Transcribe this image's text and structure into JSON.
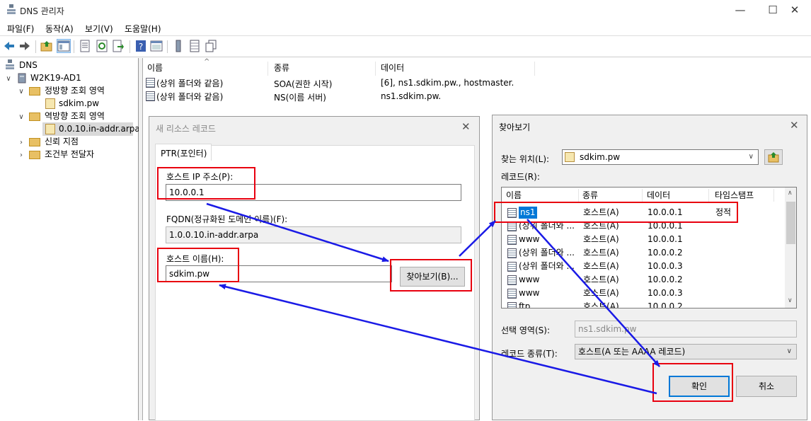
{
  "app": {
    "title": "DNS 관리자",
    "window_controls": {
      "minimize": "—",
      "maximize": "☐",
      "close": "✕"
    }
  },
  "menu": [
    "파일(F)",
    "동작(A)",
    "보기(V)",
    "도움말(H)"
  ],
  "tree": {
    "root": "DNS",
    "server": "W2K19-AD1",
    "forward_zone": "정방향 조회 영역",
    "forward_child": "sdkim.pw",
    "reverse_zone": "역방향 조회 영역",
    "reverse_child": "0.0.10.in-addr.arpa",
    "trust": "신뢰 지점",
    "conditional": "조건부 전달자"
  },
  "list": {
    "headers": {
      "name": "이름",
      "type": "종류",
      "data": "데이터"
    },
    "rows": [
      {
        "name": "(상위 폴더와 같음)",
        "type": "SOA(권한 시작)",
        "data": "[6], ns1.sdkim.pw., hostmaster."
      },
      {
        "name": "(상위 폴더와 같음)",
        "type": "NS(이름 서버)",
        "data": "ns1.sdkim.pw."
      }
    ]
  },
  "new_record": {
    "title": "새 리소스 레코드",
    "close": "✕",
    "tab": "PTR(포인터)",
    "ip_label": "호스트 IP 주소(P):",
    "ip_value": "10.0.0.1",
    "fqdn_label": "FQDN(정규화된 도메인 이름)(F):",
    "fqdn_value": "1.0.0.10.in-addr.arpa",
    "host_label": "호스트 이름(H):",
    "host_value": "sdkim.pw",
    "browse_button": "찾아보기(B)..."
  },
  "browse": {
    "title": "찾아보기",
    "close": "✕",
    "lookin_label": "찾는 위치(L):",
    "lookin_value": "sdkim.pw",
    "records_label": "레코드(R):",
    "headers": {
      "name": "이름",
      "type": "종류",
      "data": "데이터",
      "timestamp": "타임스탬프"
    },
    "rows": [
      {
        "name": "ns1",
        "type": "호스트(A)",
        "data": "10.0.0.1",
        "ts": "정적"
      },
      {
        "name": "(상위 폴더와 ...",
        "type": "호스트(A)",
        "data": "10.0.0.1",
        "ts": ""
      },
      {
        "name": "www",
        "type": "호스트(A)",
        "data": "10.0.0.1",
        "ts": ""
      },
      {
        "name": "(상위 폴더와 ...",
        "type": "호스트(A)",
        "data": "10.0.0.2",
        "ts": ""
      },
      {
        "name": "(상위 폴더와 ...",
        "type": "호스트(A)",
        "data": "10.0.0.3",
        "ts": ""
      },
      {
        "name": "www",
        "type": "호스트(A)",
        "data": "10.0.0.2",
        "ts": ""
      },
      {
        "name": "www",
        "type": "호스트(A)",
        "data": "10.0.0.3",
        "ts": ""
      },
      {
        "name": "ftp",
        "type": "호스트(A)",
        "data": "10.0.0.2",
        "ts": ""
      }
    ],
    "selection_label": "선택 영역(S):",
    "selection_value": "ns1.sdkim.pw",
    "rectype_label": "레코드 종류(T):",
    "rectype_value": "호스트(A 또는 AAAA 레코드)",
    "ok": "확인",
    "cancel": "취소"
  },
  "colors": {
    "highlight": "#e8000f",
    "arrow": "#1a1ae6",
    "selection": "#0078d7"
  }
}
